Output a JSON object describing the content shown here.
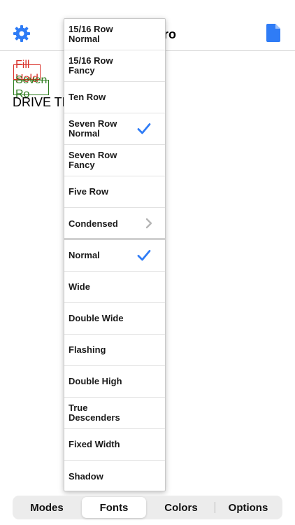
{
  "header": {
    "title_fragment": "ro"
  },
  "preview": {
    "line1": "Fill Hold",
    "line2": "Seven Ro",
    "line3": "DRIVE TH"
  },
  "menu": {
    "items": [
      {
        "label": "15/16 Row Normal",
        "checked": false
      },
      {
        "label": "15/16 Row Fancy",
        "checked": false
      },
      {
        "label": "Ten Row",
        "checked": false
      },
      {
        "label": "Seven Row Normal",
        "checked": true
      },
      {
        "label": "Seven Row Fancy",
        "checked": false
      },
      {
        "label": "Five Row",
        "checked": false
      },
      {
        "label": "Condensed",
        "submenu": true
      },
      {
        "label": "Normal",
        "checked": true
      },
      {
        "label": "Wide",
        "checked": false
      },
      {
        "label": "Double Wide",
        "checked": false
      },
      {
        "label": "Flashing",
        "checked": false
      },
      {
        "label": "Double High",
        "checked": false
      },
      {
        "label": "True Descenders",
        "checked": false
      },
      {
        "label": "Fixed Width",
        "checked": false
      },
      {
        "label": "Shadow",
        "checked": false
      }
    ]
  },
  "tabs": {
    "items": [
      "Modes",
      "Fonts",
      "Colors",
      "Options"
    ],
    "selected": "Fonts"
  },
  "colors": {
    "accent": "#2f7cf6",
    "fill_hold": "#d9322b",
    "seven_row": "#2e7d1f"
  },
  "icons": {
    "settings": "gear-icon",
    "document": "document-icon",
    "checkmark": "checkmark-icon",
    "chevron": "chevron-right-icon"
  }
}
